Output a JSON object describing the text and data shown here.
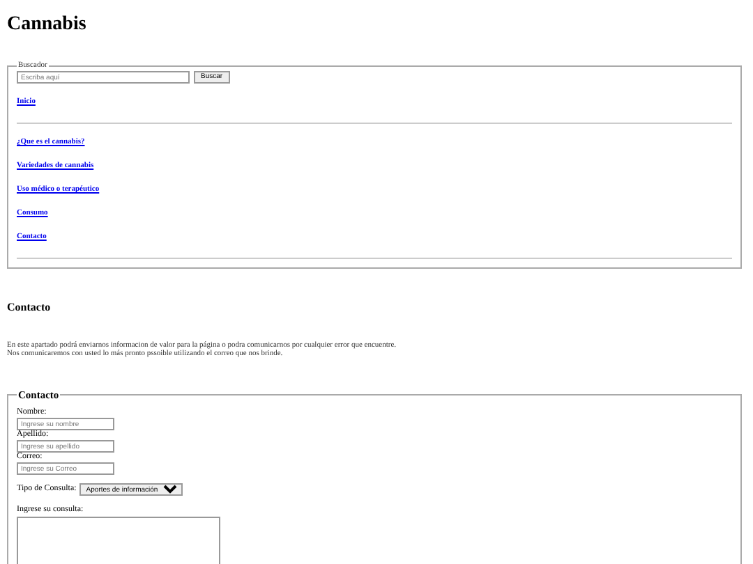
{
  "page_title": "Cannabis",
  "search": {
    "legend": "Buscador",
    "placeholder": "Escriba aquí",
    "button": "Buscar"
  },
  "nav_top": "Inicio",
  "nav_links": [
    "¿Que es el cannabis?",
    "Variedades de cannabis",
    "Uso médico o terapéutico",
    "Consumo",
    "Contacto"
  ],
  "section_title": "Contacto",
  "intro": [
    "En este apartado podrá enviarnos informacion de valor para la página o podra comunicarnos por cualquier error que encuentre.",
    "Nos comunicaremos con usted lo más pronto pssoible utilizando el correo que nos brinde."
  ],
  "form": {
    "legend": "Contacto",
    "fields": [
      {
        "label": "Nombre:",
        "placeholder": "Ingrese su nombre"
      },
      {
        "label": "Apellido:",
        "placeholder": "Ingrese su apellido"
      },
      {
        "label": "Correo:",
        "placeholder": "Ingrese su Correo"
      }
    ],
    "type_label": "Tipo de Consulta:",
    "type_value": "Aportes de información",
    "message_label": "Ingrese su consulta:"
  }
}
